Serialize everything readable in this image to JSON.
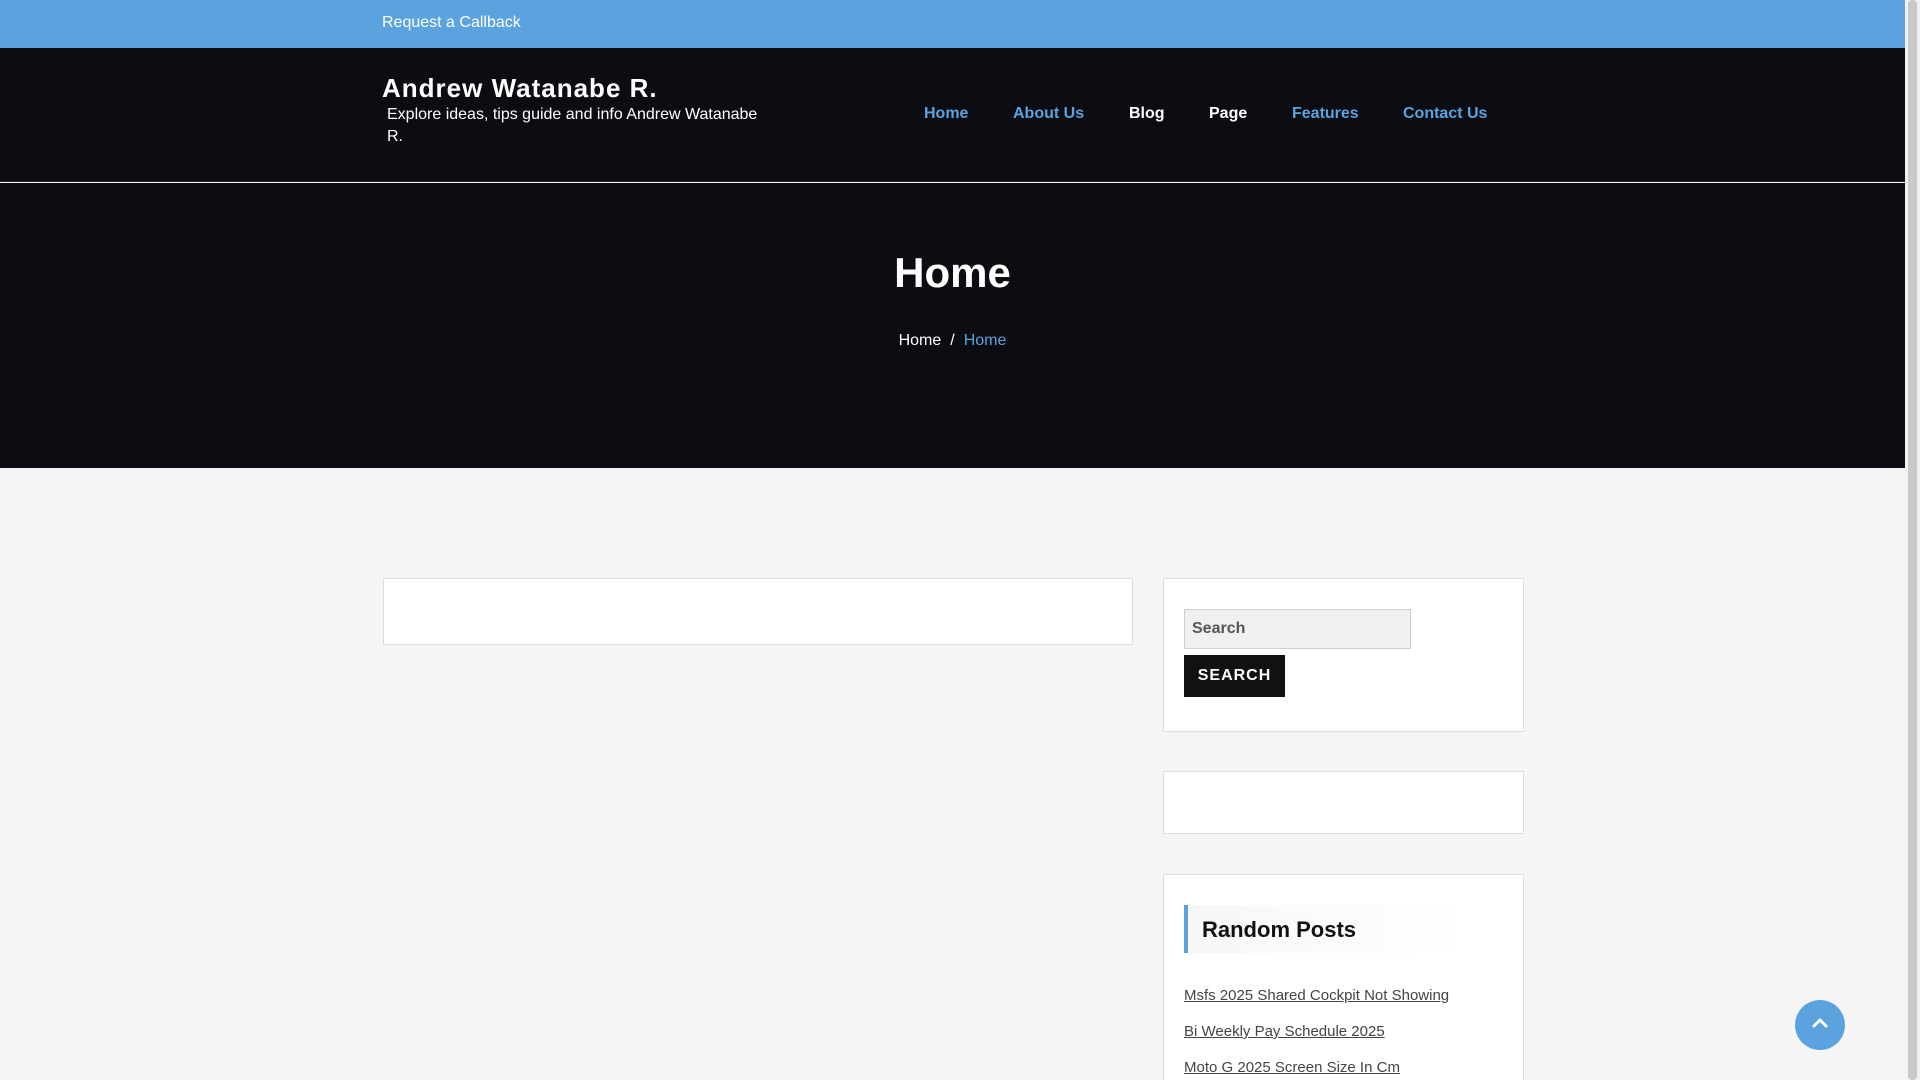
{
  "topbar": {
    "callback_label": "Request a Callback"
  },
  "site": {
    "title": "Andrew Watanabe R.",
    "description": "Explore ideas, tips guide and info Andrew Watanabe R."
  },
  "nav": {
    "items": [
      {
        "label": "Home",
        "color": "#5ba3de"
      },
      {
        "label": "About Us",
        "color": "#5ba3de"
      },
      {
        "label": "Blog",
        "color": "#ffffff"
      },
      {
        "label": "Page",
        "color": "#ffffff"
      },
      {
        "label": "Features",
        "color": "#5ba3de"
      },
      {
        "label": "Contact Us",
        "color": "#5ba3de"
      }
    ]
  },
  "hero": {
    "title": "Home",
    "breadcrumb": {
      "home": "Home",
      "separator": "/",
      "current": "Home"
    }
  },
  "sidebar": {
    "search": {
      "placeholder": "Search",
      "button_label": "SEARCH"
    },
    "random_posts": {
      "title": "Random Posts",
      "items": [
        "Msfs 2025 Shared Cockpit Not Showing",
        "Bi Weekly Pay Schedule 2025",
        "Moto G 2025 Screen Size In Cm"
      ]
    }
  },
  "icons": {
    "back_to_top": "chevron-up-icon"
  },
  "colors": {
    "accent": "#5ba3de",
    "dark_bg": "#0b0d12"
  }
}
